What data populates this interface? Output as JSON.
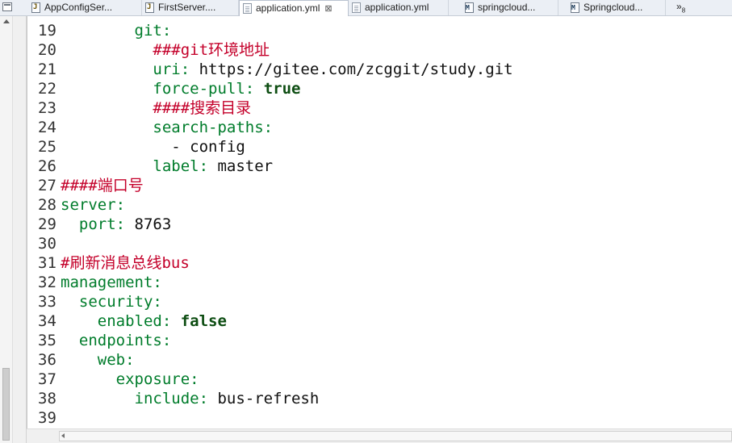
{
  "tabs": [
    {
      "label": "AppConfigSer...",
      "icon": "java-file-icon",
      "glyph": "J"
    },
    {
      "label": "FirstServer....",
      "icon": "java-file-icon",
      "glyph": "J"
    },
    {
      "label": "application.yml",
      "icon": "yml-file-icon",
      "glyph": "",
      "active": true
    },
    {
      "label": "application.yml",
      "icon": "yml-file-icon",
      "glyph": ""
    },
    {
      "label": "springcloud...",
      "icon": "markdown-file-icon",
      "glyph": "M"
    },
    {
      "label": "Springcloud...",
      "icon": "markdown-file-icon",
      "glyph": "M"
    }
  ],
  "active_tab_close": "⊠",
  "tab_overflow": {
    "symbol": "»",
    "count": "8"
  },
  "colors": {
    "key": "#007c2b",
    "value": "#101010",
    "boolean": "#0d4d12",
    "comment": "#c4002a",
    "line_number": "#333333"
  },
  "code_lines": [
    {
      "num": "19",
      "segments": [
        {
          "t": "        ",
          "c": "val"
        },
        {
          "t": "git:",
          "c": "key"
        }
      ]
    },
    {
      "num": "20",
      "segments": [
        {
          "t": "          ",
          "c": "val"
        },
        {
          "t": "###git",
          "c": "comment"
        },
        {
          "t": "环境地址",
          "c": "comment cn"
        }
      ]
    },
    {
      "num": "21",
      "segments": [
        {
          "t": "          ",
          "c": "val"
        },
        {
          "t": "uri:",
          "c": "key"
        },
        {
          "t": " https://gitee.com/zcggit/study.git",
          "c": "val"
        }
      ]
    },
    {
      "num": "22",
      "segments": [
        {
          "t": "          ",
          "c": "val"
        },
        {
          "t": "force-pull:",
          "c": "key"
        },
        {
          "t": " ",
          "c": "val"
        },
        {
          "t": "true",
          "c": "bool"
        }
      ]
    },
    {
      "num": "23",
      "segments": [
        {
          "t": "          ",
          "c": "val"
        },
        {
          "t": "####",
          "c": "comment"
        },
        {
          "t": "搜索目录",
          "c": "comment cn"
        }
      ]
    },
    {
      "num": "24",
      "segments": [
        {
          "t": "          ",
          "c": "val"
        },
        {
          "t": "search-paths:",
          "c": "key"
        }
      ]
    },
    {
      "num": "25",
      "segments": [
        {
          "t": "            - config",
          "c": "val"
        }
      ]
    },
    {
      "num": "26",
      "segments": [
        {
          "t": "          ",
          "c": "val"
        },
        {
          "t": "label:",
          "c": "key"
        },
        {
          "t": " master",
          "c": "val"
        }
      ]
    },
    {
      "num": "27",
      "segments": [
        {
          "t": "####",
          "c": "comment"
        },
        {
          "t": "端口号",
          "c": "comment cn"
        }
      ]
    },
    {
      "num": "28",
      "segments": [
        {
          "t": "server:",
          "c": "key"
        }
      ]
    },
    {
      "num": "29",
      "segments": [
        {
          "t": "  ",
          "c": "val"
        },
        {
          "t": "port:",
          "c": "key"
        },
        {
          "t": " 8763",
          "c": "val"
        }
      ]
    },
    {
      "num": "30",
      "segments": []
    },
    {
      "num": "31",
      "segments": [
        {
          "t": "#",
          "c": "comment"
        },
        {
          "t": "刷新消息总线",
          "c": "comment cn"
        },
        {
          "t": "bus",
          "c": "comment"
        }
      ]
    },
    {
      "num": "32",
      "segments": [
        {
          "t": "management:",
          "c": "key"
        }
      ]
    },
    {
      "num": "33",
      "segments": [
        {
          "t": "  ",
          "c": "val"
        },
        {
          "t": "security:",
          "c": "key"
        }
      ]
    },
    {
      "num": "34",
      "segments": [
        {
          "t": "    ",
          "c": "val"
        },
        {
          "t": "enabled:",
          "c": "key"
        },
        {
          "t": " ",
          "c": "val"
        },
        {
          "t": "false",
          "c": "bool"
        }
      ]
    },
    {
      "num": "35",
      "segments": [
        {
          "t": "  ",
          "c": "val"
        },
        {
          "t": "endpoints:",
          "c": "key"
        }
      ]
    },
    {
      "num": "36",
      "segments": [
        {
          "t": "    ",
          "c": "val"
        },
        {
          "t": "web:",
          "c": "key"
        }
      ]
    },
    {
      "num": "37",
      "segments": [
        {
          "t": "      ",
          "c": "val"
        },
        {
          "t": "exposure:",
          "c": "key"
        }
      ]
    },
    {
      "num": "38",
      "segments": [
        {
          "t": "        ",
          "c": "val"
        },
        {
          "t": "include:",
          "c": "key"
        },
        {
          "t": " bus-refresh",
          "c": "val"
        }
      ]
    },
    {
      "num": "39",
      "segments": []
    }
  ]
}
